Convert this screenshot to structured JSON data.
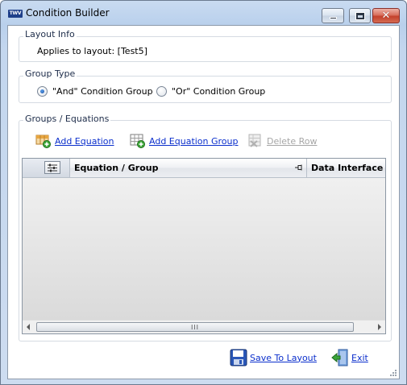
{
  "window": {
    "title": "Condition Builder",
    "app_icon_text": "TWV"
  },
  "layout_info": {
    "label": "Layout Info",
    "applies_text": "Applies to layout: [Test5]"
  },
  "group_type": {
    "label": "Group Type",
    "options": [
      {
        "label": "\"And\" Condition Group",
        "checked": true
      },
      {
        "label": "\"Or\" Condition Group",
        "checked": false
      }
    ]
  },
  "groups": {
    "label": "Groups / Equations",
    "toolbar": {
      "add_equation": "Add Equation",
      "add_equation_group": "Add Equation Group",
      "delete_row": "Delete Row"
    },
    "grid": {
      "columns": [
        "Equation / Group",
        "Data Interface"
      ],
      "scroll_thumb": "III"
    }
  },
  "footer": {
    "save_label": "Save To Layout",
    "exit_label": "Exit"
  },
  "colors": {
    "link": "#0b2fcc",
    "disabled": "#a6a6a6",
    "title_bg": "#c9dbf1"
  }
}
